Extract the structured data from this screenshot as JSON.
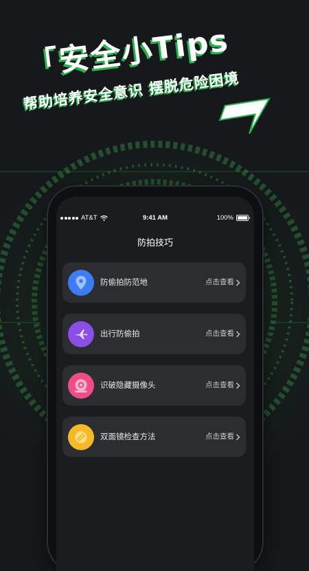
{
  "banner": {
    "title": "「安全小Tips",
    "subtitle": "帮助培养安全意识 摆脱危险困境"
  },
  "status_bar": {
    "carrier": "AT&T",
    "time": "9:41 AM",
    "battery": "100%"
  },
  "page": {
    "title": "防拍技巧"
  },
  "items": [
    {
      "label": "防偷拍防范地",
      "action": "点击查看",
      "icon": "location-pin-icon",
      "color": "#3d7cf5"
    },
    {
      "label": "出行防偷拍",
      "action": "点击查看",
      "icon": "airplane-icon",
      "color": "#8a4fe6"
    },
    {
      "label": "识破隐藏摄像头",
      "action": "点击查看",
      "icon": "camera-lens-icon",
      "color": "#ef4d86"
    },
    {
      "label": "双面镜检查方法",
      "action": "点击查看",
      "icon": "mirror-icon",
      "color": "#f5b827"
    }
  ],
  "colors": {
    "accent_green": "#27b34b",
    "card_bg": "#2b2d31",
    "screen_bg": "#1b1c1f"
  }
}
